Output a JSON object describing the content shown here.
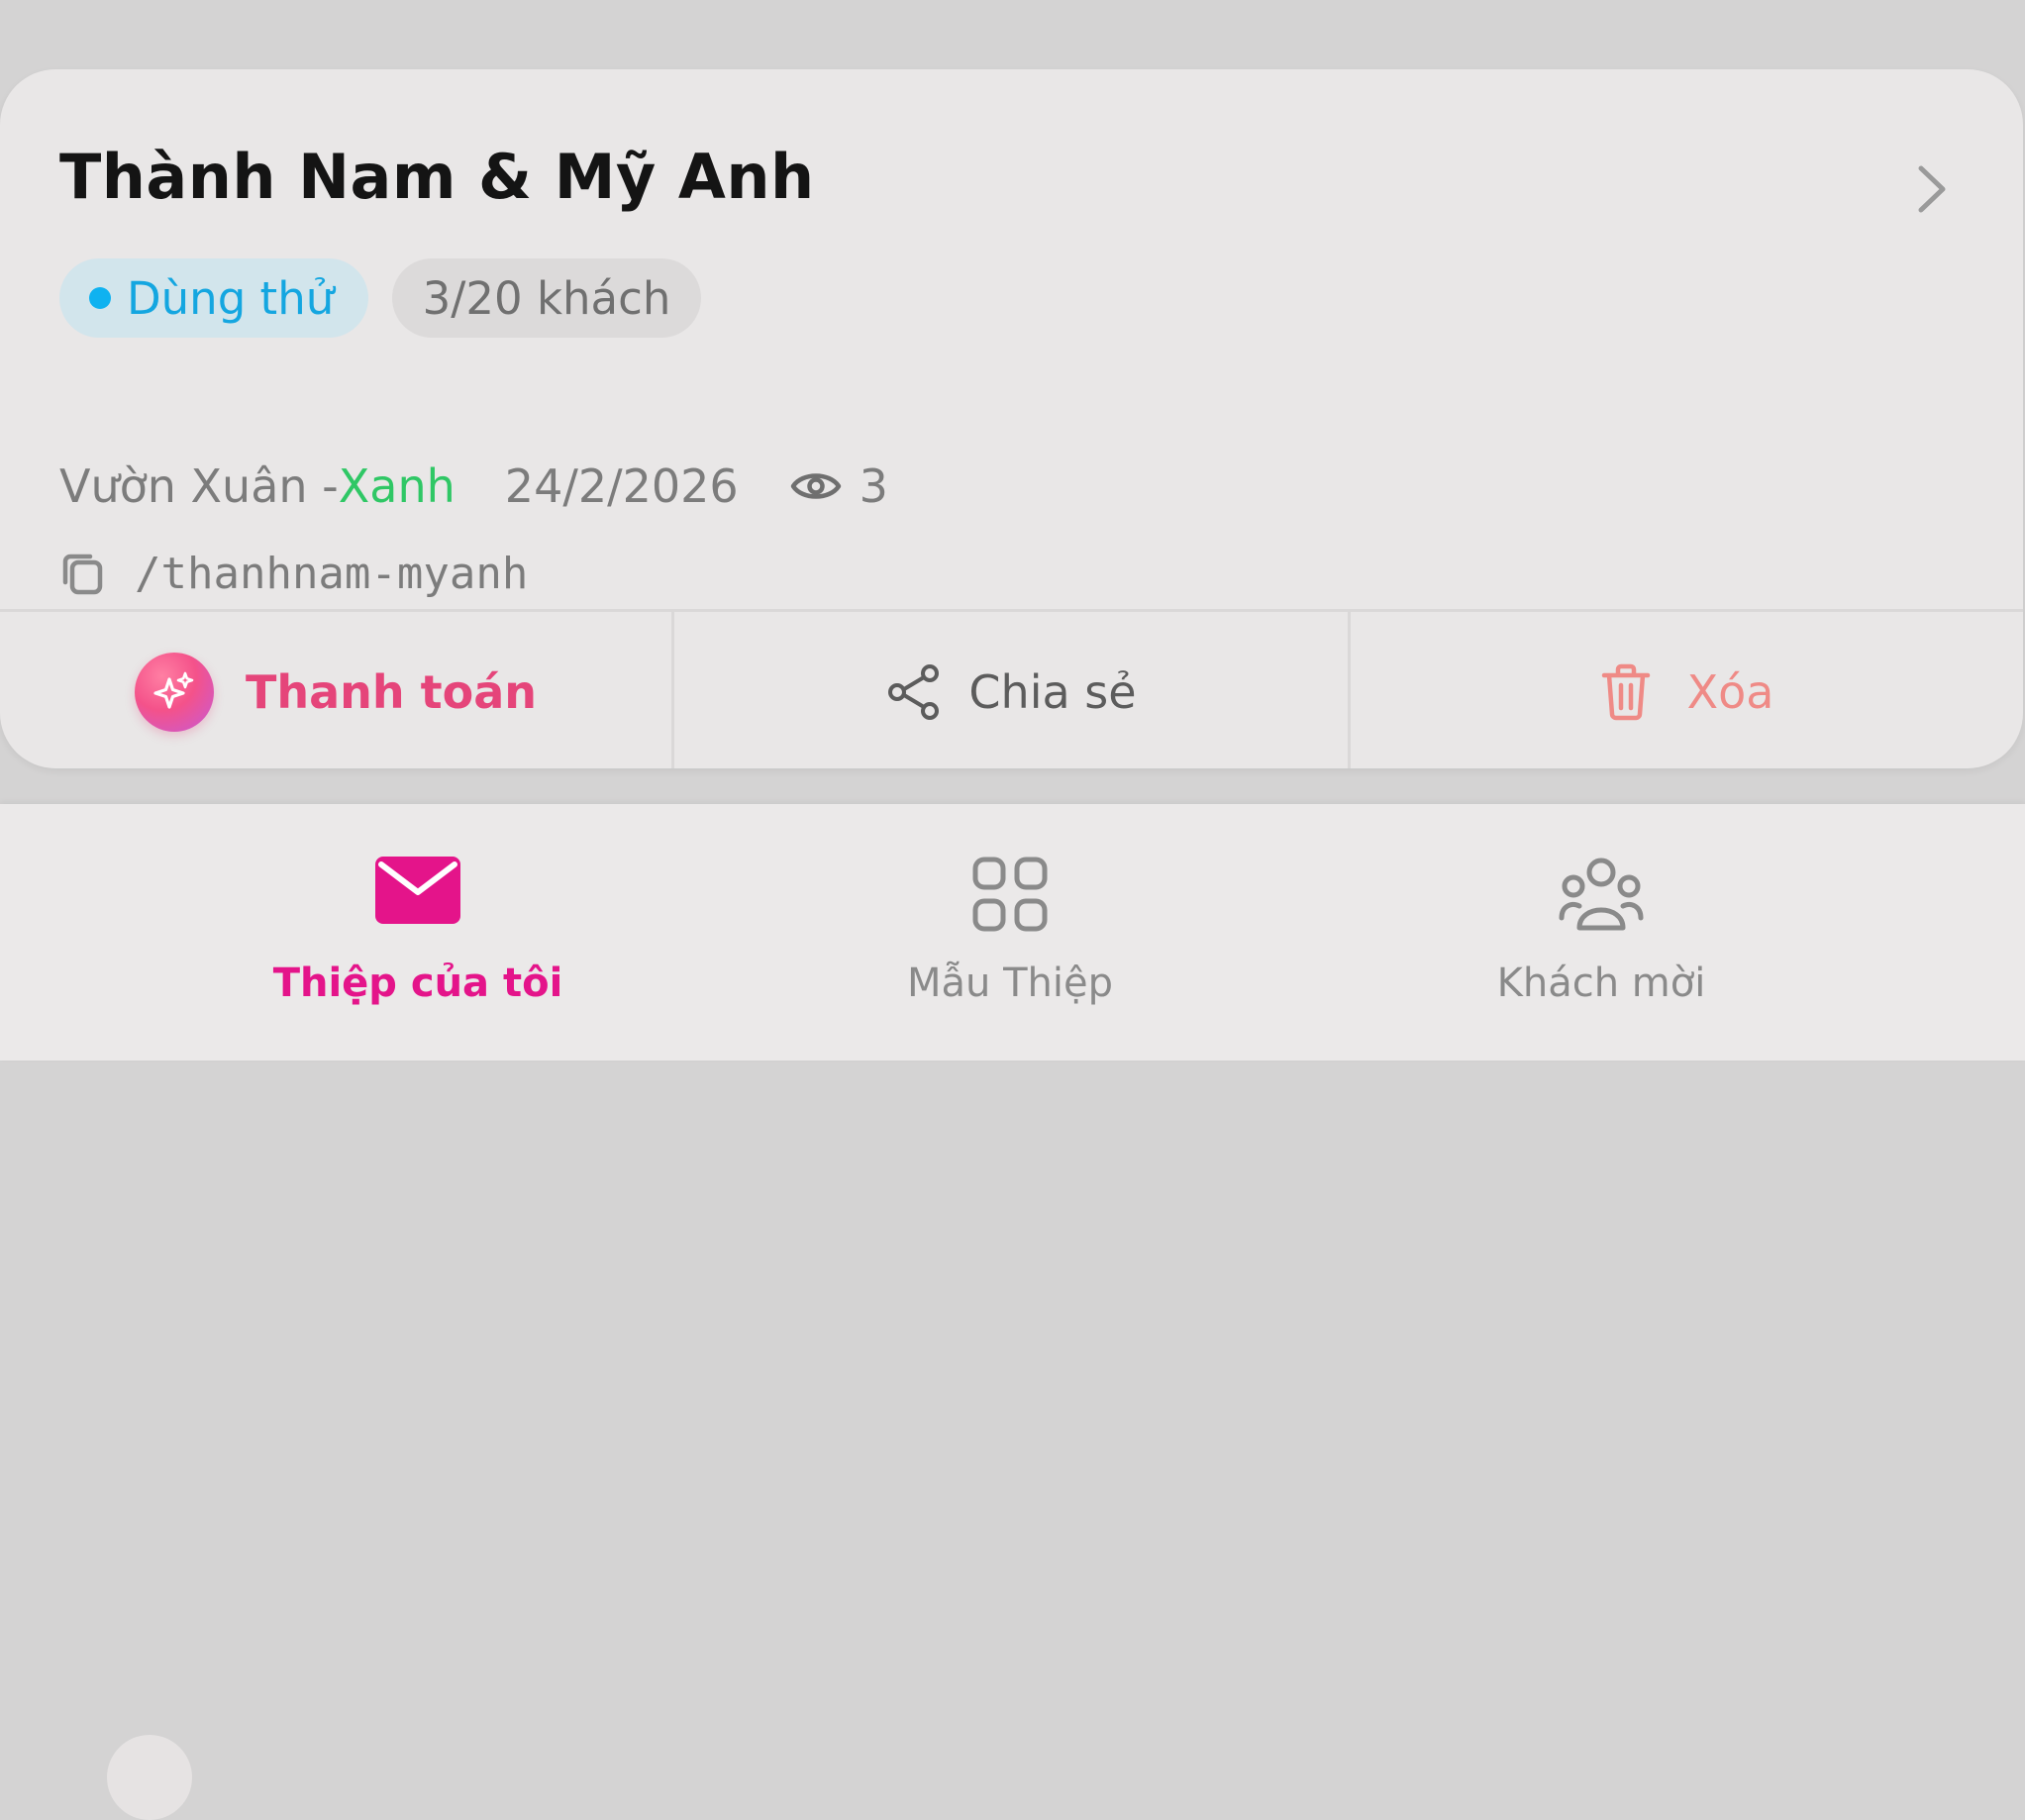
{
  "card": {
    "title": "Thành Nam & Mỹ Anh",
    "status_badge": "Dùng thử",
    "guest_badge": "3/20 khách",
    "template_name": "Vườn Xuân - ",
    "template_color": "Xanh",
    "date": "24/2/2026",
    "views": "3",
    "slug": "/thanhnam-myanh"
  },
  "actions": {
    "pay": "Thanh toán",
    "share": "Chia sẻ",
    "delete": "Xóa"
  },
  "nav": {
    "my_cards": "Thiệp của tôi",
    "templates": "Mẫu Thiệp",
    "guests": "Khách mời"
  },
  "colors": {
    "accent_pink": "#e4148a",
    "trial_blue": "#14a6e0",
    "template_green": "#2fc765",
    "delete_red": "#ef8a86"
  },
  "icons": {
    "chevron": "chevron-right-icon",
    "views": "eye-icon",
    "copy": "copy-icon",
    "pay": "sparkle-icon",
    "share": "share-icon",
    "delete": "trash-icon",
    "nav_my_cards": "envelope-icon",
    "nav_templates": "grid-icon",
    "nav_guests": "users-icon"
  }
}
